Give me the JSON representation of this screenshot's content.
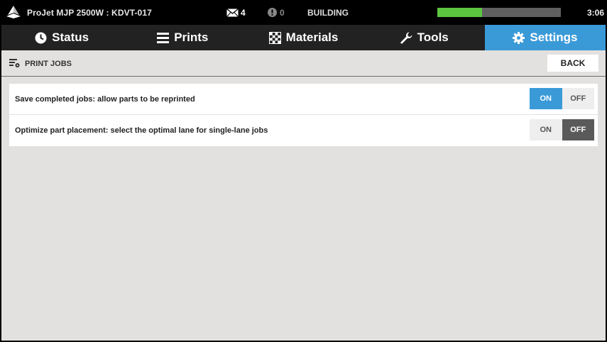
{
  "status_bar": {
    "printer_name": "ProJet MJP 2500W : KDVT-017",
    "mail_count": "4",
    "alert_count": "0",
    "build_status": "BUILDING",
    "progress_fraction": 0.36,
    "time": "3:06"
  },
  "tabs": [
    {
      "label": "Status",
      "icon": "clock-icon"
    },
    {
      "label": "Prints",
      "icon": "list-icon"
    },
    {
      "label": "Materials",
      "icon": "checker-icon"
    },
    {
      "label": "Tools",
      "icon": "wrench-icon"
    },
    {
      "label": "Settings",
      "icon": "gear-icon",
      "active": true
    }
  ],
  "section": {
    "title": "PRINT JOBS",
    "back_label": "BACK"
  },
  "settings": [
    {
      "label": "Save completed jobs: allow parts to be reprinted",
      "on_label": "ON",
      "off_label": "OFF",
      "value": "ON"
    },
    {
      "label": "Optimize part placement: select the optimal lane for single-lane jobs",
      "on_label": "ON",
      "off_label": "OFF",
      "value": "OFF"
    }
  ],
  "colors": {
    "accent": "#3a9ad8",
    "progress": "#5cc540",
    "off_selected": "#5a5a5a"
  }
}
